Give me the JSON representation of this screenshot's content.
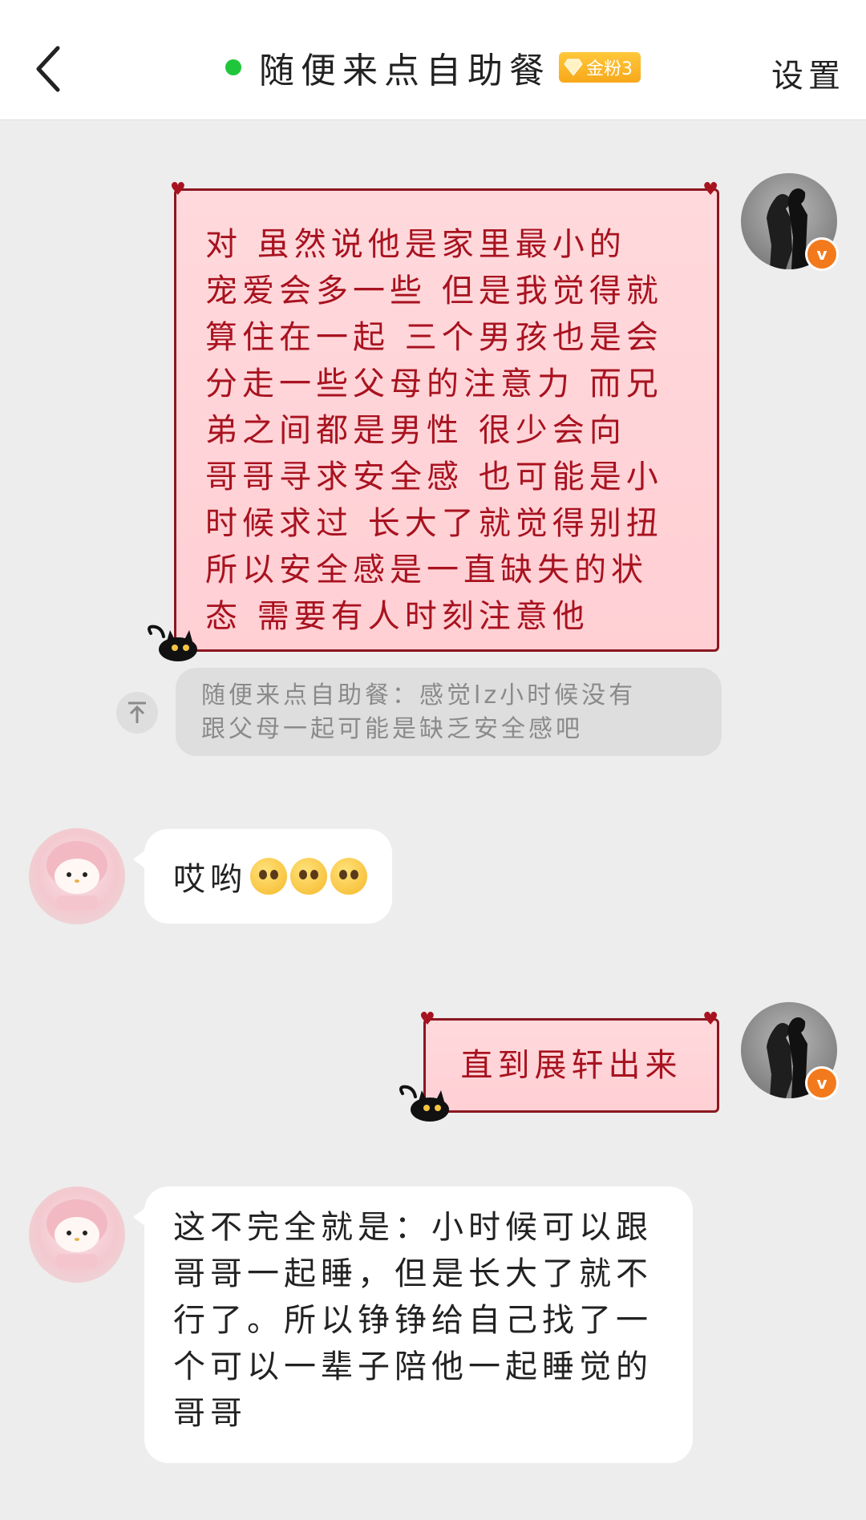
{
  "header": {
    "back_icon": "chevron-left-icon",
    "title": "随便来点自助餐",
    "online_color": "#1fc63c",
    "fan_badge": "金粉3",
    "settings_label": "设置"
  },
  "messages": [
    {
      "sender": "self",
      "style": "pink-card",
      "lines": [
        "对 虽然说他是家里最小的",
        "宠爱会多一些 但是我觉得就",
        "算住在一起 三个男孩也是会",
        "分走一些父母的注意力 而兄",
        "弟之间都是男性 很少会向",
        "哥哥寻求安全感 也可能是小",
        "时候求过 长大了就觉得别扭",
        "所以安全感是一直缺失的状",
        "态 需要有人时刻注意他"
      ]
    },
    {
      "sender": "self",
      "style": "quote",
      "quote_icon": "quote-top-icon",
      "lines": [
        "随便来点自助餐：感觉lz小时候没有",
        "跟父母一起可能是缺乏安全感吧"
      ]
    },
    {
      "sender": "other",
      "style": "white",
      "text": "哎哟",
      "emoji_icon": "pleading-face-emoji",
      "emoji_count": 3
    },
    {
      "sender": "self",
      "style": "pink-card",
      "lines": [
        "直到展轩出来"
      ]
    },
    {
      "sender": "other",
      "style": "white",
      "lines": [
        "这不完全就是：小时候可以跟",
        "哥哥一起睡，但是长大了就不",
        "行了。所以铮铮给自己找了一",
        "个可以一辈子陪他一起睡觉的",
        "哥哥"
      ]
    }
  ],
  "colors": {
    "card_border": "#8b1720",
    "card_text": "#a8121f",
    "card_bg": "#ffd4d8",
    "page_bg": "#ededed",
    "verified_badge": "#f37a1c"
  }
}
